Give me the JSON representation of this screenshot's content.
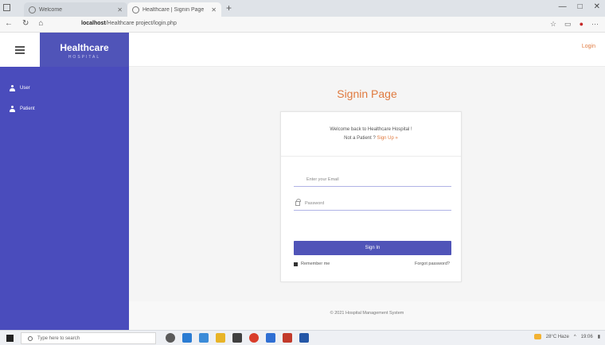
{
  "browser": {
    "tabs": [
      {
        "title": "Welcome",
        "active": false
      },
      {
        "title": "Healthcare | Signin Page",
        "active": true
      }
    ],
    "new_tab_symbol": "+",
    "url_host": "localhost",
    "url_path": "/Healthcare project/login.php",
    "window_controls": [
      "—",
      "□",
      "✕"
    ],
    "nav_icons": [
      "back-icon",
      "refresh-icon",
      "home-icon"
    ]
  },
  "header": {
    "brand_title": "Healthcare",
    "brand_subtitle": "HOSPITAL",
    "login_link": "Login"
  },
  "sidebar": {
    "items": [
      {
        "label": "User",
        "icon": "user-icon"
      },
      {
        "label": "Patient",
        "icon": "user-icon"
      }
    ]
  },
  "main": {
    "page_title": "Signin Page",
    "welcome_text": "Welcome back to Healthcare Hospital !",
    "not_patient_text": "Not a Patient ?",
    "signup_link": "Sign Up »",
    "email_placeholder": "Enter your Email",
    "password_placeholder": "Password",
    "signin_button": "Sign In",
    "remember_label": "Remember me",
    "forgot_link": "Forgot password?"
  },
  "footer": {
    "text": "© 2021 Hospital Management System"
  },
  "taskbar": {
    "search_placeholder": "Type here to search",
    "tray_text": "28°C Haze",
    "time_text": "19:06"
  },
  "colors": {
    "sidebar": "#4a4cbc",
    "brand": "#5054b8",
    "accent": "#e07a3f"
  }
}
